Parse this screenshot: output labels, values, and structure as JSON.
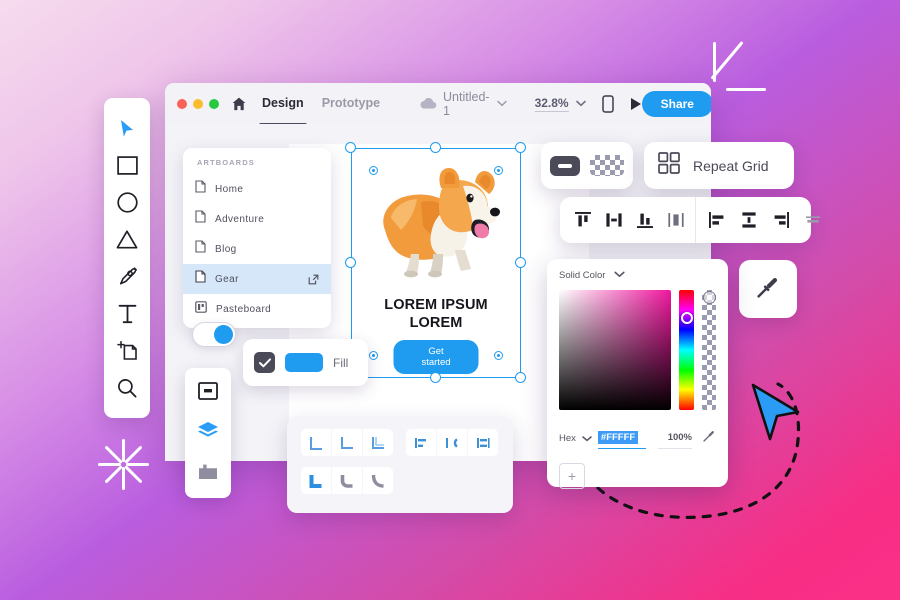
{
  "app": {
    "window_controls": [
      "close",
      "minimize",
      "maximize"
    ],
    "home_icon": "home-icon",
    "tabs": [
      {
        "label": "Design",
        "active": true
      },
      {
        "label": "Prototype",
        "active": false
      }
    ],
    "cloud_icon": "cloud-icon",
    "file_name": "Untitled-1",
    "file_chevron": "chevron-down-icon",
    "zoom_level": "32.8%",
    "zoom_chevron": "chevron-down-icon",
    "device_preview_icon": "device-preview-icon",
    "play_icon": "play-icon",
    "share_label": "Share"
  },
  "artboards": {
    "title": "ARTBOARDS",
    "items": [
      {
        "label": "Home",
        "icon": "artboard-icon",
        "selected": false,
        "external": false
      },
      {
        "label": "Adventure",
        "icon": "artboard-icon",
        "selected": false,
        "external": false
      },
      {
        "label": "Blog",
        "icon": "artboard-icon",
        "selected": false,
        "external": false
      },
      {
        "label": "Gear",
        "icon": "artboard-icon",
        "selected": true,
        "external": true
      },
      {
        "label": "Pasteboard",
        "icon": "pasteboard-icon",
        "selected": false,
        "external": false
      }
    ]
  },
  "tools": {
    "items": [
      {
        "name": "select-tool",
        "icon": "cursor-icon",
        "active": true
      },
      {
        "name": "rectangle-tool",
        "icon": "rectangle-icon",
        "active": false
      },
      {
        "name": "ellipse-tool",
        "icon": "ellipse-icon",
        "active": false
      },
      {
        "name": "polygon-tool",
        "icon": "triangle-icon",
        "active": false
      },
      {
        "name": "pen-tool",
        "icon": "pen-icon",
        "active": false
      },
      {
        "name": "text-tool",
        "icon": "text-icon",
        "active": false
      },
      {
        "name": "artboard-tool",
        "icon": "artboard-add-icon",
        "active": false
      },
      {
        "name": "zoom-tool",
        "icon": "magnifier-icon",
        "active": false
      }
    ]
  },
  "side_panel": {
    "items": [
      {
        "name": "components-panel",
        "icon": "component-icon",
        "active": false
      },
      {
        "name": "layers-panel",
        "icon": "layers-icon",
        "active": true
      },
      {
        "name": "library-panel",
        "icon": "library-icon",
        "active": false
      }
    ]
  },
  "fill_card": {
    "checkbox_checked": true,
    "swatch_color": "#1F9CF0",
    "label": "Fill"
  },
  "toggle": {
    "state": "on",
    "knob_color": "#1F9CF0"
  },
  "canvas": {
    "illustration": "corgi-dog-illustration",
    "heading": "LOREM IPSUM\nLOREM",
    "heading_line_1": "LOREM IPSUM",
    "heading_line_2": "LOREM",
    "button_label": "Get started",
    "selection_color": "#1F9CF0"
  },
  "opacity_panel": {
    "solid_icon": "solid-fill-icon",
    "checker_icon": "transparency-checker-icon"
  },
  "repeat_grid": {
    "icon": "grid-icon",
    "label": "Repeat Grid"
  },
  "align_toolbar": {
    "group_1": [
      {
        "name": "align-top-icon"
      },
      {
        "name": "align-horizontal-center-icon"
      },
      {
        "name": "align-bottom-icon"
      },
      {
        "name": "align-vertical-center-icon"
      }
    ],
    "group_2": [
      {
        "name": "align-left-icon"
      },
      {
        "name": "distribute-vertical-icon"
      },
      {
        "name": "align-right-icon"
      },
      {
        "name": "distribute-horizontal-icon"
      }
    ]
  },
  "color_picker": {
    "mode_label": "Solid Color",
    "mode_chevron": "chevron-down-icon",
    "format_label": "Hex",
    "format_chevron": "chevron-down-icon",
    "hex_value": "#FFFFF",
    "opacity_value": "100%",
    "eyedropper_icon": "eyedropper-icon",
    "add_swatch_label": "+",
    "gradient_hue": "#F0179F"
  },
  "eyedropper_button": {
    "icon": "eyedropper-icon"
  },
  "corner_panel": {
    "row_1_group_1": [
      "border-top-left-icon",
      "border-bottom-left-icon",
      "border-all-icon"
    ],
    "row_1_group_2": [
      "text-align-left-icon",
      "text-wrap-icon",
      "text-indent-icon"
    ],
    "row_2_group_1": [
      "corner-sharp-icon",
      "corner-rounded-icon",
      "corner-smooth-icon"
    ]
  },
  "decorations": {
    "sparkle": "sparkle-burst",
    "corner_lines": "abstract-lines",
    "dashed_path": "dashed-curve",
    "cursor": "blue-arrow-cursor"
  }
}
